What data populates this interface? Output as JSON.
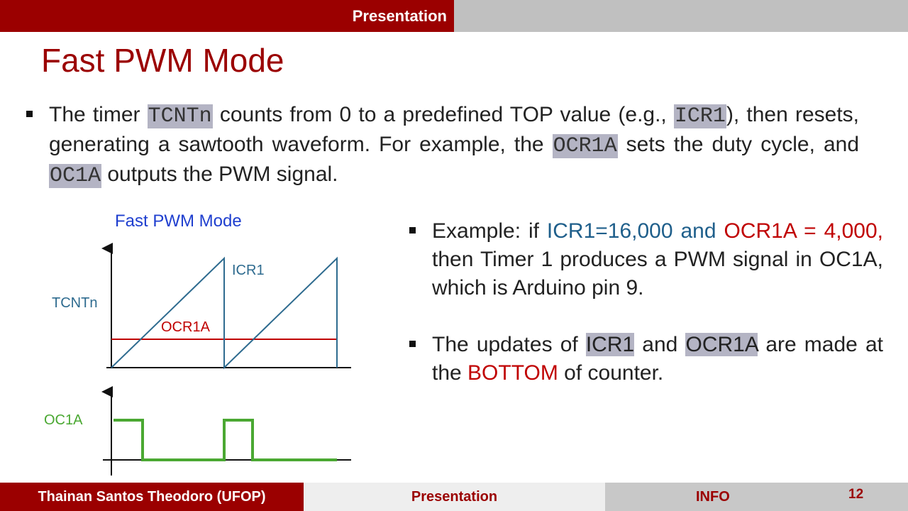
{
  "header": {
    "section": "Presentation"
  },
  "slide": {
    "title": "Fast PWM Mode"
  },
  "bullet1": {
    "t1": "The timer ",
    "c1": "TCNTn",
    "t2": " counts from 0 to a predefined TOP value (e.g., ",
    "c2": "ICR1",
    "t3": "), then resets, generating a sawtooth waveform. For example, the ",
    "c3": "OCR1A",
    "t4": " sets the duty cycle, and ",
    "c4": "OC1A",
    "t5": " outputs the PWM signal."
  },
  "diagram": {
    "title": "Fast PWM Mode",
    "tcnt_label": "TCNTn",
    "icr_label": "ICR1",
    "ocr_label": "OCR1A",
    "oc_label": "OC1A",
    "colors": {
      "title": "#1f3fcf",
      "sawtooth": "#2e6b8f",
      "threshold": "#c00000",
      "pwm": "#4aa832"
    }
  },
  "bullet2": {
    "t1": "Example: if ",
    "b1": "ICR1=16,000 and",
    "r1": "OCR1A = 4,000,",
    "t2": " then Timer 1 produces a PWM signal in OC1A, which is Arduino pin 9."
  },
  "bullet3": {
    "t1": "The updates of ",
    "h1": "ICR1",
    "t2": " and ",
    "h2": "OCR1A",
    "t3": " are made at the ",
    "r1": "BOTTOM",
    "t4": " of counter."
  },
  "footer": {
    "author": "Thainan Santos Theodoro (UFOP)",
    "section": "Presentation",
    "subsection": "INFO",
    "page": "12"
  }
}
